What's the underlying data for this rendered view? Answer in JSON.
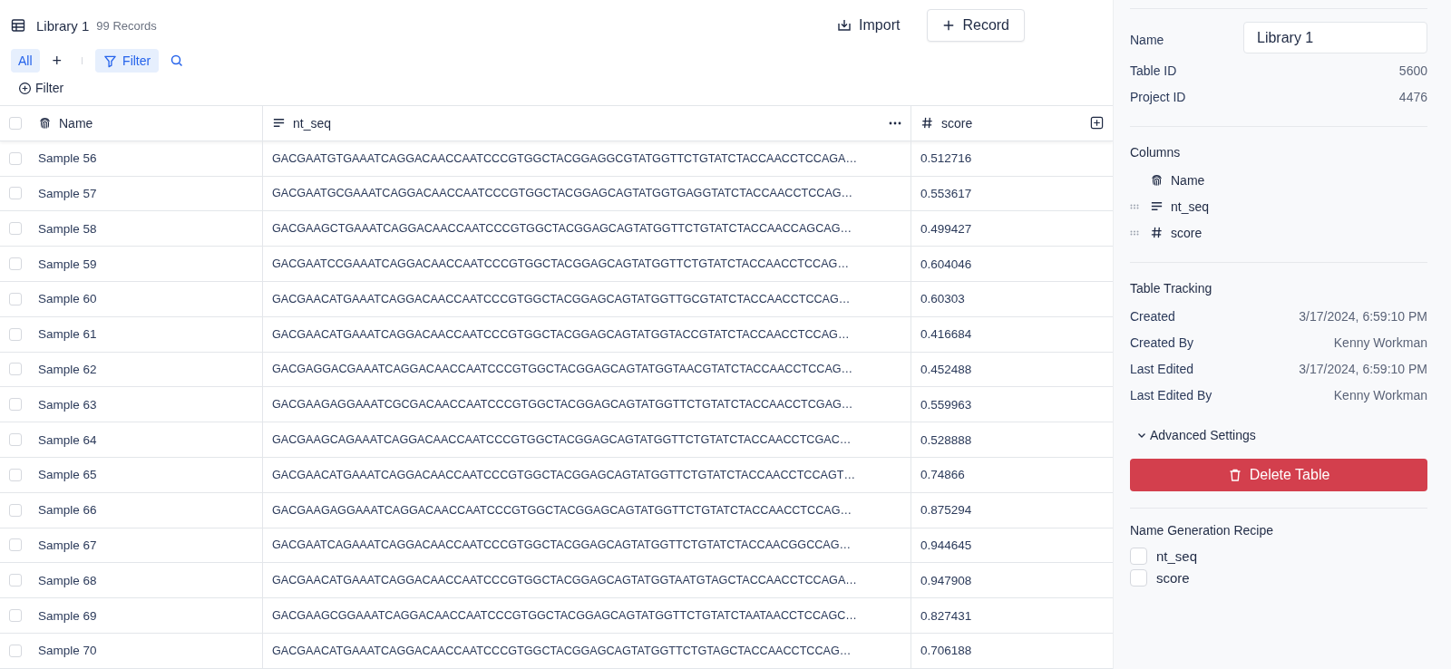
{
  "table_header": {
    "title": "Library 1",
    "count": "99 Records",
    "import_label": "Import",
    "record_label": "Record"
  },
  "views": [
    {
      "label": "All",
      "selected": true
    }
  ],
  "toolbar": {
    "add_view": "+",
    "filter_label": "Filter",
    "add_filter_label": "Filter"
  },
  "table": {
    "select_all": {
      "checked": false
    },
    "columns": [
      {
        "label": "Name",
        "kind": "name"
      },
      {
        "label": "nt_seq",
        "kind": "text"
      },
      {
        "label": "score",
        "kind": "number"
      }
    ],
    "rows": [
      {
        "name": "Sample 56",
        "nt_seq": "GACGAATGTGAAATCAGGACAACCAATCCCGTGGCTACGGAGGCGTATGGTTCTGTATCTACCAACCTCCAGA…",
        "score": "0.512716",
        "checked": false
      },
      {
        "name": "Sample 57",
        "nt_seq": "GACGAATGCGAAATCAGGACAACCAATCCCGTGGCTACGGAGCAGTATGGTGAGGTATCTACCAACCTCCAG…",
        "score": "0.553617",
        "checked": false
      },
      {
        "name": "Sample 58",
        "nt_seq": "GACGAAGCTGAAATCAGGACAACCAATCCCGTGGCTACGGAGCAGTATGGTTCTGTATCTACCAACCAGCAG…",
        "score": "0.499427",
        "checked": false
      },
      {
        "name": "Sample 59",
        "nt_seq": "GACGAATCCGAAATCAGGACAACCAATCCCGTGGCTACGGAGCAGTATGGTTCTGTATCTACCAACCTCCAG…",
        "score": "0.604046",
        "checked": false
      },
      {
        "name": "Sample 60",
        "nt_seq": "GACGAACATGAAATCAGGACAACCAATCCCGTGGCTACGGAGCAGTATGGTTGCGTATCTACCAACCTCCAG…",
        "score": "0.60303",
        "checked": false
      },
      {
        "name": "Sample 61",
        "nt_seq": "GACGAACATGAAATCAGGACAACCAATCCCGTGGCTACGGAGCAGTATGGTACCGTATCTACCAACCTCCAG…",
        "score": "0.416684",
        "checked": false
      },
      {
        "name": "Sample 62",
        "nt_seq": "GACGAGGACGAAATCAGGACAACCAATCCCGTGGCTACGGAGCAGTATGGTAACGTATCTACCAACCTCCAG…",
        "score": "0.452488",
        "checked": false
      },
      {
        "name": "Sample 63",
        "nt_seq": "GACGAAGAGGAAATCGCGACAACCAATCCCGTGGCTACGGAGCAGTATGGTTCTGTATCTACCAACCTCGAG…",
        "score": "0.559963",
        "checked": false
      },
      {
        "name": "Sample 64",
        "nt_seq": "GACGAAGCAGAAATCAGGACAACCAATCCCGTGGCTACGGAGCAGTATGGTTCTGTATCTACCAACCTCGAC…",
        "score": "0.528888",
        "checked": false
      },
      {
        "name": "Sample 65",
        "nt_seq": "GACGAACATGAAATCAGGACAACCAATCCCGTGGCTACGGAGCAGTATGGTTCTGTATCTACCAACCTCCAGT…",
        "score": "0.74866",
        "checked": false
      },
      {
        "name": "Sample 66",
        "nt_seq": "GACGAAGAGGAAATCAGGACAACCAATCCCGTGGCTACGGAGCAGTATGGTTCTGTATCTACCAACCTCCAG…",
        "score": "0.875294",
        "checked": false
      },
      {
        "name": "Sample 67",
        "nt_seq": "GACGAATCAGAAATCAGGACAACCAATCCCGTGGCTACGGAGCAGTATGGTTCTGTATCTACCAACGGCCAG…",
        "score": "0.944645",
        "checked": false
      },
      {
        "name": "Sample 68",
        "nt_seq": "GACGAACATGAAATCAGGACAACCAATCCCGTGGCTACGGAGCAGTATGGTAATGTAGCTACCAACCTCCAGA…",
        "score": "0.947908",
        "checked": false
      },
      {
        "name": "Sample 69",
        "nt_seq": "GACGAAGCGGAAATCAGGACAACCAATCCCGTGGCTACGGAGCAGTATGGTTCTGTATCTAATAACCTCCAGC…",
        "score": "0.827431",
        "checked": false
      },
      {
        "name": "Sample 70",
        "nt_seq": "GACGAACATGAAATCAGGACAACCAATCCCGTGGCTACGGAGCAGTATGGTTCTGTAGCTACCAACCTCCAG…",
        "score": "0.706188",
        "checked": false
      }
    ]
  },
  "sidebar": {
    "name_label": "Name",
    "name_value": "Library 1",
    "ids": [
      {
        "label": "Table ID",
        "value": "5600"
      },
      {
        "label": "Project ID",
        "value": "4476"
      }
    ],
    "columns_title": "Columns",
    "columns": [
      {
        "label": "Name",
        "kind": "name"
      },
      {
        "label": "nt_seq",
        "kind": "text"
      },
      {
        "label": "score",
        "kind": "number"
      }
    ],
    "tracking_title": "Table Tracking",
    "tracking": [
      {
        "label": "Created",
        "value": "3/17/2024, 6:59:10 PM"
      },
      {
        "label": "Created By",
        "value": "Kenny Workman"
      },
      {
        "label": "Last Edited",
        "value": "3/17/2024, 6:59:10 PM"
      },
      {
        "label": "Last Edited By",
        "value": "Kenny Workman"
      }
    ],
    "advanced": {
      "label": "Advanced Settings",
      "expanded": false
    },
    "delete_label": "Delete Table",
    "recipe_title": "Name Generation Recipe",
    "recipe": [
      {
        "label": "nt_seq",
        "checked": false
      },
      {
        "label": "score",
        "checked": false
      }
    ]
  }
}
